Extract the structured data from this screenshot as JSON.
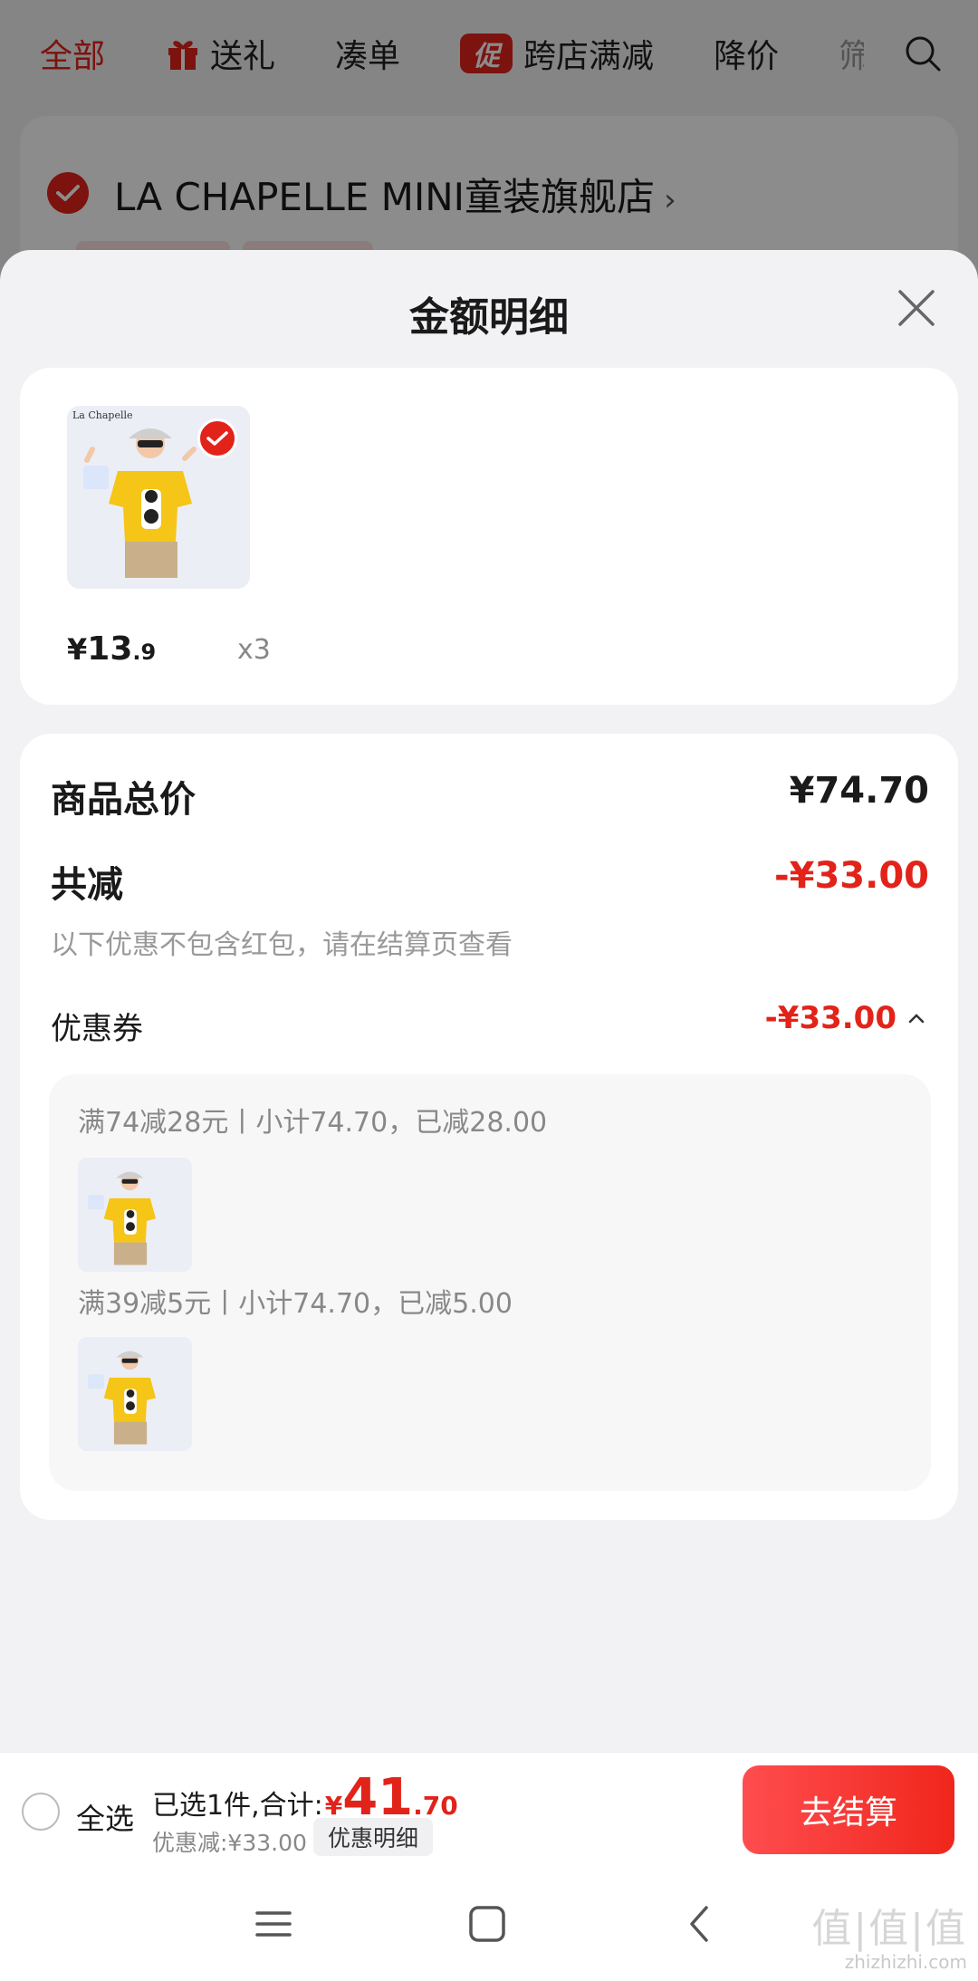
{
  "top_tabs": {
    "items": [
      {
        "label": "全部",
        "active": true
      },
      {
        "label": "送礼",
        "icon": "gift-icon"
      },
      {
        "label": "凑单"
      },
      {
        "label": "跨店满减",
        "badge": "促"
      },
      {
        "label": "降价"
      }
    ],
    "cut_tab": "筛",
    "search_icon": "search-icon"
  },
  "store": {
    "name": "LA CHAPELLE MINI童装旗舰店",
    "arrow": "›"
  },
  "sheet": {
    "title": "金额明细",
    "close_icon": "close-icon"
  },
  "product": {
    "brand_on_image": "La Chapelle",
    "price_yen": "¥",
    "price_int": "13",
    "price_dec": ".9",
    "quantity": "x3"
  },
  "summary": {
    "total_label": "商品总价",
    "total_value": "¥74.70",
    "reduction_label": "共减",
    "reduction_value": "-¥33.00",
    "note": "以下优惠不包含红包，请在结算页查看",
    "coupon_label": "优惠券",
    "coupon_value": "-¥33.00",
    "coupon_lines": [
      "满74减28元丨小计74.70，已减28.00",
      "满39减5元丨小计74.70，已减5.00"
    ]
  },
  "bottom_bar": {
    "select_all": "全选",
    "selected_prefix": "已选1件,合计:",
    "total_yen": "¥",
    "total_int": "41",
    "total_dec": ".70",
    "discount_text": "优惠减:¥33.00",
    "detail_chip": "优惠明细",
    "checkout": "去结算"
  },
  "watermark": {
    "big": "值|值|值",
    "small": "zhizhizhi.com"
  },
  "colors": {
    "accent_red": "#e2231a",
    "product_shirt": "#f5c518",
    "background": "#f2f2f4"
  }
}
